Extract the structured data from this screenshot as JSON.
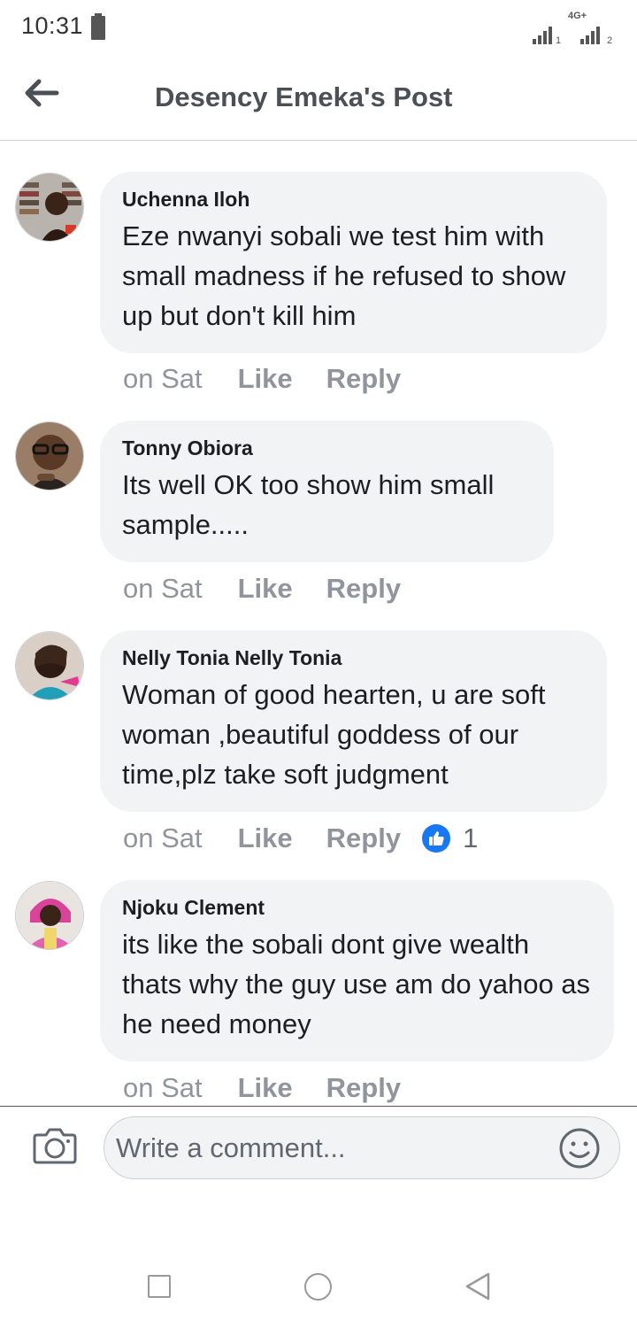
{
  "status_bar": {
    "time": "10:31",
    "network_type": "4G+",
    "sim1_label": "1",
    "sim2_label": "2"
  },
  "header": {
    "title": "Desency Emeka's Post",
    "back_icon": "arrow-left-icon"
  },
  "comments": [
    {
      "author": "Uchenna Iloh",
      "text": "Eze nwanyi sobali we test him with small madness if he refused to show up but don't kill him",
      "time": "on Sat",
      "like_label": "Like",
      "reply_label": "Reply"
    },
    {
      "author": "Tonny Obiora",
      "text": "Its well OK too show him small sample.....",
      "time": "on Sat",
      "like_label": "Like",
      "reply_label": "Reply"
    },
    {
      "author": "Nelly Tonia Nelly Tonia",
      "text": "Woman of good hearten, u are soft woman ,beautiful goddess of our time,plz take soft judgment",
      "time": "on Sat",
      "like_label": "Like",
      "reply_label": "Reply",
      "reaction_count": "1",
      "reaction_icon": "thumbs-up-icon"
    },
    {
      "author": "Njoku Clement",
      "text": "its like the sobali dont give wealth thats why the guy use am do yahoo as he need money",
      "time": "on Sat",
      "like_label": "Like",
      "reply_label": "Reply"
    }
  ],
  "composer": {
    "placeholder": "Write a comment...",
    "camera_icon": "camera-icon",
    "emoji_icon": "smiley-icon"
  },
  "colors": {
    "bubble_bg": "#f2f3f5",
    "meta_text": "#90949c",
    "title_text": "#4b4f56",
    "reaction_blue": "#1877f2"
  }
}
